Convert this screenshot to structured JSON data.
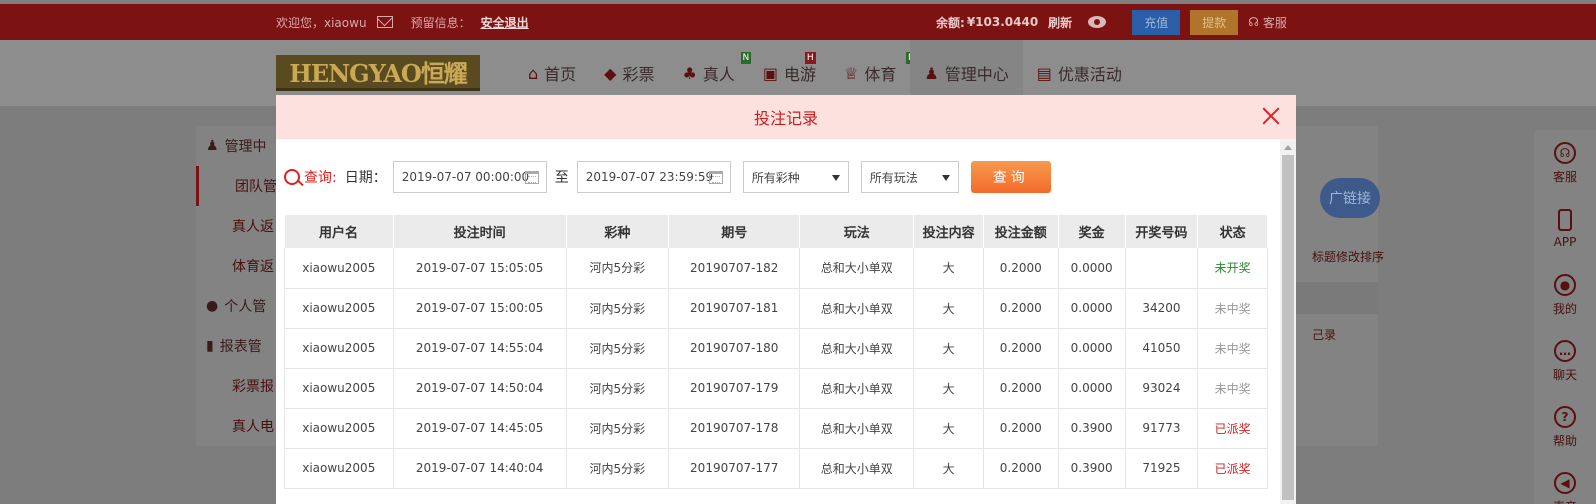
{
  "topbar": {
    "welcome": "欢迎您，xiaowu",
    "notice_label": "预留信息：",
    "logout": "安全退出",
    "balance_label": "余额:",
    "balance_value": "¥103.0440",
    "refresh": "刷新",
    "deposit": "充值",
    "withdraw": "提款",
    "service": "客服"
  },
  "logo": "HENGYAO恒耀",
  "nav": [
    {
      "icon": "home-icon",
      "label": "首页"
    },
    {
      "icon": "ticket-icon",
      "label": "彩票"
    },
    {
      "icon": "dealer-icon",
      "label": "真人",
      "badge": "N"
    },
    {
      "icon": "slot-icon",
      "label": "电游",
      "badge": "H"
    },
    {
      "icon": "trophy-icon",
      "label": "体育",
      "badge": "N"
    },
    {
      "icon": "team-icon",
      "label": "管理中心"
    },
    {
      "icon": "gift-icon",
      "label": "优惠活动"
    }
  ],
  "sidebar": [
    "管理中",
    "团队管",
    "真人返",
    "体育返",
    "个人管",
    "报表管",
    "彩票报",
    "真人电"
  ],
  "rightpanel": {
    "button": "广链接",
    "text1": "标题修改排序",
    "text2": "己录"
  },
  "floatbar": [
    "客服",
    "APP",
    "我的",
    "聊天",
    "帮助",
    "声音"
  ],
  "modal": {
    "title": "投注记录",
    "query_label": "查询:",
    "date_label": "日期：",
    "start_date": "2019-07-07 00:00:00",
    "to": "至",
    "end_date": "2019-07-07 23:59:59",
    "lottery_select": "所有彩种",
    "play_select": "所有玩法",
    "query_button": "查询"
  },
  "table": {
    "headers": [
      "用户名",
      "投注时间",
      "彩种",
      "期号",
      "玩法",
      "投注内容",
      "投注金额",
      "奖金",
      "开奖号码",
      "状态"
    ],
    "rows": [
      [
        "xiaowu2005",
        "2019-07-07 15:05:05",
        "河内5分彩",
        "20190707-182",
        "总和大小单双",
        "大",
        "0.2000",
        "0.0000",
        "",
        "未开奖"
      ],
      [
        "xiaowu2005",
        "2019-07-07 15:00:05",
        "河内5分彩",
        "20190707-181",
        "总和大小单双",
        "大",
        "0.2000",
        "0.0000",
        "34200",
        "未中奖"
      ],
      [
        "xiaowu2005",
        "2019-07-07 14:55:04",
        "河内5分彩",
        "20190707-180",
        "总和大小单双",
        "大",
        "0.2000",
        "0.0000",
        "41050",
        "未中奖"
      ],
      [
        "xiaowu2005",
        "2019-07-07 14:50:04",
        "河内5分彩",
        "20190707-179",
        "总和大小单双",
        "大",
        "0.2000",
        "0.0000",
        "93024",
        "未中奖"
      ],
      [
        "xiaowu2005",
        "2019-07-07 14:45:05",
        "河内5分彩",
        "20190707-178",
        "总和大小单双",
        "大",
        "0.2000",
        "0.3900",
        "91773",
        "已派奖"
      ],
      [
        "xiaowu2005",
        "2019-07-07 14:40:04",
        "河内5分彩",
        "20190707-177",
        "总和大小单双",
        "大",
        "0.2000",
        "0.3900",
        "71925",
        "已派奖"
      ]
    ]
  }
}
